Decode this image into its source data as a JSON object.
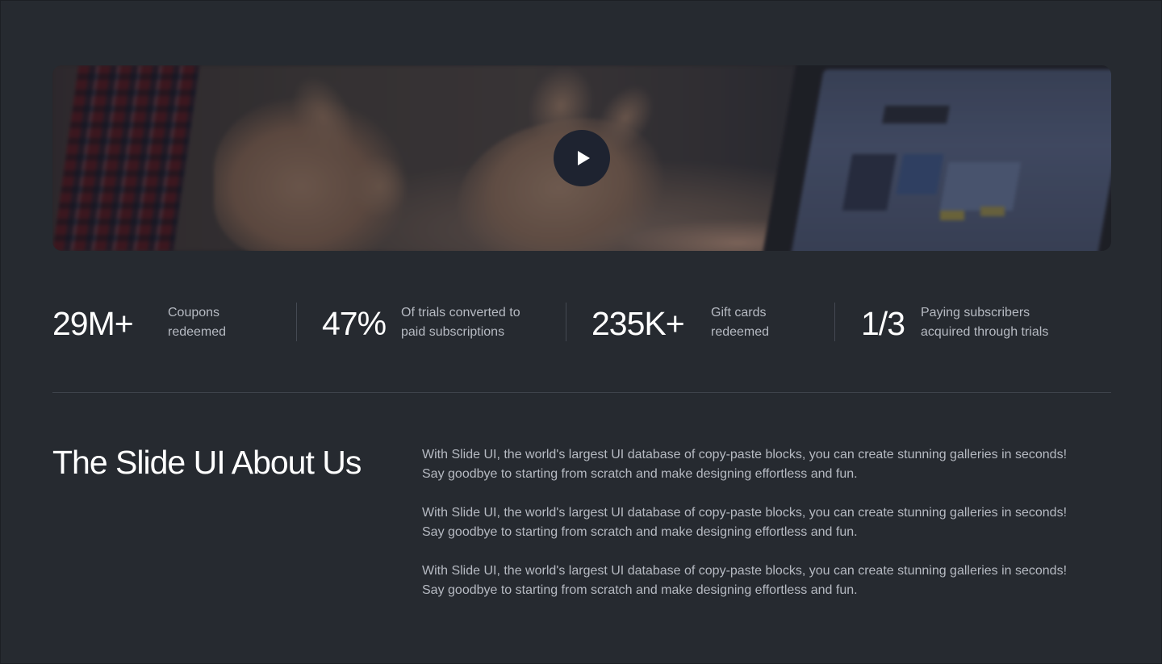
{
  "hero": {
    "video_label": "Play video"
  },
  "stats": [
    {
      "value": "29M+",
      "label_line1": "Coupons",
      "label_line2": "redeemed"
    },
    {
      "value": "47%",
      "label_line1": "Of trials converted to",
      "label_line2": "paid subscriptions"
    },
    {
      "value": "235K+",
      "label_line1": "Gift cards",
      "label_line2": "redeemed"
    },
    {
      "value": "1/3",
      "label_line1": "Paying subscribers",
      "label_line2": "acquired through trials"
    }
  ],
  "about": {
    "title": "The Slide UI About Us",
    "paragraphs": [
      {
        "line1": "With Slide UI, the world's largest UI database of copy-paste blocks, you can create stunning galleries in seconds!",
        "line2": "Say goodbye to starting from scratch and make designing effortless and fun."
      },
      {
        "line1": "With Slide UI, the world's largest UI database of copy-paste blocks, you can create stunning galleries in seconds!",
        "line2": "Say goodbye to starting from scratch and make designing effortless and fun."
      },
      {
        "line1": "With Slide UI, the world's largest UI database of copy-paste blocks, you can create stunning galleries in seconds!",
        "line2": "Say goodbye to starting from scratch and make designing effortless and fun."
      }
    ]
  },
  "colors": {
    "background": "#262a30",
    "text_primary": "#ffffff",
    "text_secondary": "#b6bac2",
    "play_button": "#1e2330",
    "divider": "#3e434b"
  },
  "icons": {
    "play": "play-icon"
  }
}
